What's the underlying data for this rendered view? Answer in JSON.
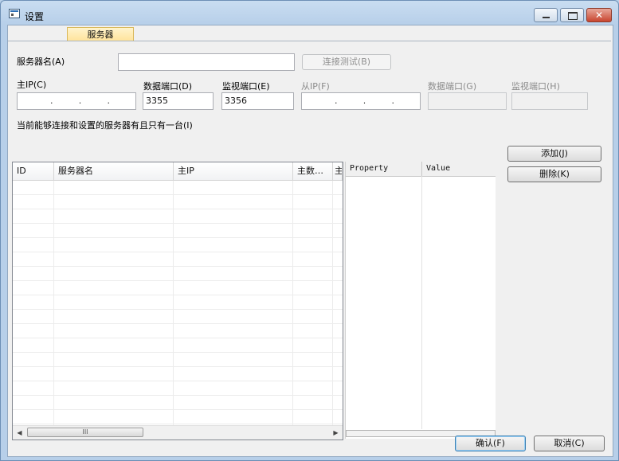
{
  "window": {
    "title": "设置"
  },
  "tabs": [
    {
      "label": "服务器"
    }
  ],
  "form": {
    "server_name_label": "服务器名(A)",
    "server_name_value": "",
    "test_button": "连接测试(B)",
    "main_ip_label": "主IP(C)",
    "data_port_label": "数据端口(D)",
    "data_port_value": "3355",
    "monitor_port_label": "监视端口(E)",
    "monitor_port_value": "3356",
    "slave_ip_label": "从IP(F)",
    "slave_data_port_label": "数据端口(G)",
    "slave_monitor_port_label": "监视端口(H)",
    "note": "当前能够连接和设置的服务器有且只有一台(I)"
  },
  "grid": {
    "columns": [
      "ID",
      "服务器名",
      "主IP",
      "主数…",
      "主"
    ],
    "scroll_thumb": "III"
  },
  "properties": {
    "columns": [
      "Property",
      "Value"
    ]
  },
  "side_buttons": {
    "add": "添加(J)",
    "delete": "删除(K)"
  },
  "footer": {
    "ok": "确认(F)",
    "cancel": "取消(C)"
  }
}
